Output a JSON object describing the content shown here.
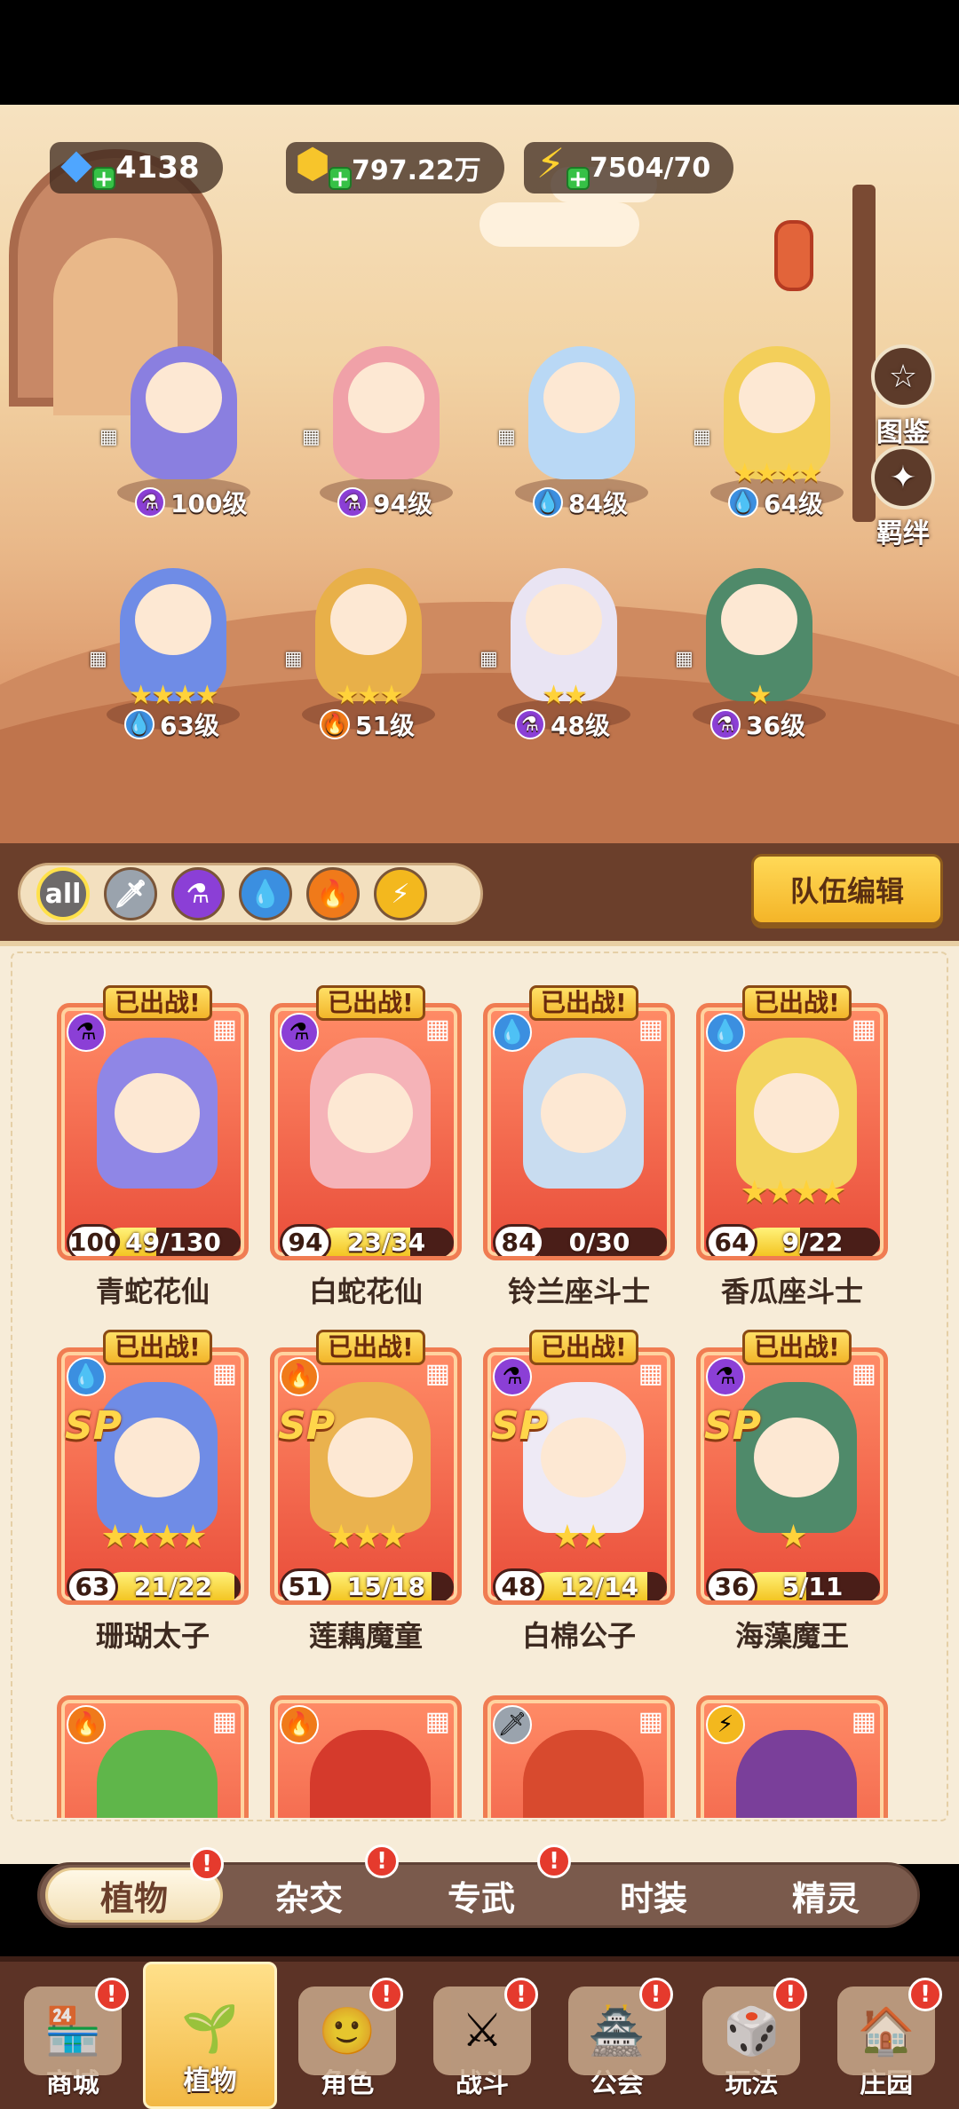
{
  "resources": {
    "gems": "4138",
    "coins": "797.22万",
    "energy": "7504/70"
  },
  "side_buttons": {
    "codex": "图鉴",
    "bonds": "羁绊"
  },
  "lineup": [
    {
      "level": "100级",
      "element": "poison",
      "stars": 0
    },
    {
      "level": "94级",
      "element": "poison",
      "stars": 0
    },
    {
      "level": "84级",
      "element": "water",
      "stars": 0
    },
    {
      "level": "64级",
      "element": "water",
      "stars": 4
    },
    {
      "level": "63级",
      "element": "water",
      "stars": 4
    },
    {
      "level": "51级",
      "element": "fire",
      "stars": 3
    },
    {
      "level": "48级",
      "element": "poison",
      "stars": 2
    },
    {
      "level": "36级",
      "element": "poison",
      "stars": 1
    }
  ],
  "filters": [
    "all",
    "sword",
    "poison",
    "water",
    "fire",
    "lightning"
  ],
  "team_edit": "队伍编辑",
  "deployed_label": "已出战!",
  "sp_label": "SP",
  "cards": [
    {
      "name": "青蛇花仙",
      "level": "100",
      "progress": "49/130",
      "progress_value": 0.377,
      "element": "poison",
      "stars": 0,
      "sp": false,
      "deployed": true
    },
    {
      "name": "白蛇花仙",
      "level": "94",
      "progress": "23/34",
      "progress_value": 0.676,
      "element": "poison",
      "stars": 0,
      "sp": false,
      "deployed": true
    },
    {
      "name": "铃兰座斗士",
      "level": "84",
      "progress": "0/30",
      "progress_value": 0,
      "element": "water",
      "stars": 0,
      "sp": false,
      "deployed": true
    },
    {
      "name": "香瓜座斗士",
      "level": "64",
      "progress": "9/22",
      "progress_value": 0.409,
      "element": "water",
      "stars": 4,
      "sp": false,
      "deployed": true
    },
    {
      "name": "珊瑚太子",
      "level": "63",
      "progress": "21/22",
      "progress_value": 0.955,
      "element": "water",
      "stars": 4,
      "sp": true,
      "deployed": true
    },
    {
      "name": "莲藕魔童",
      "level": "51",
      "progress": "15/18",
      "progress_value": 0.833,
      "element": "fire",
      "stars": 3,
      "sp": true,
      "deployed": true
    },
    {
      "name": "白棉公子",
      "level": "48",
      "progress": "12/14",
      "progress_value": 0.857,
      "element": "poison",
      "stars": 2,
      "sp": true,
      "deployed": true
    },
    {
      "name": "海藻魔王",
      "level": "36",
      "progress": "5/11",
      "progress_value": 0.455,
      "element": "poison",
      "stars": 1,
      "sp": true,
      "deployed": true
    }
  ],
  "cards_partial": [
    {
      "element": "fire"
    },
    {
      "element": "fire"
    },
    {
      "element": "sword"
    },
    {
      "element": "lightning"
    }
  ],
  "category_tabs": [
    {
      "label": "植物",
      "selected": true,
      "badge": "!"
    },
    {
      "label": "杂交",
      "selected": false,
      "badge": "!"
    },
    {
      "label": "专武",
      "selected": false,
      "badge": "!"
    },
    {
      "label": "时装",
      "selected": false,
      "badge": ""
    },
    {
      "label": "精灵",
      "selected": false,
      "badge": ""
    }
  ],
  "bottom_nav": [
    {
      "label": "商城",
      "icon": "shop-icon",
      "selected": false,
      "badge": "!"
    },
    {
      "label": "植物",
      "icon": "plant-icon",
      "selected": true,
      "badge": ""
    },
    {
      "label": "角色",
      "icon": "character-icon",
      "selected": false,
      "badge": "!"
    },
    {
      "label": "战斗",
      "icon": "battle-icon",
      "selected": false,
      "badge": "!"
    },
    {
      "label": "公会",
      "icon": "guild-icon",
      "selected": false,
      "badge": "!"
    },
    {
      "label": "玩法",
      "icon": "gameplay-icon",
      "selected": false,
      "badge": "!"
    },
    {
      "label": "庄园",
      "icon": "manor-icon",
      "selected": false,
      "badge": "!"
    }
  ],
  "colors": {
    "poison": "#8b3fd6",
    "water": "#3b8fe0",
    "fire": "#f07a1a",
    "lightning": "#f3b81e",
    "sword": "#9aa3ad",
    "accent": "#ffd957",
    "badge": "#e53a2d"
  }
}
